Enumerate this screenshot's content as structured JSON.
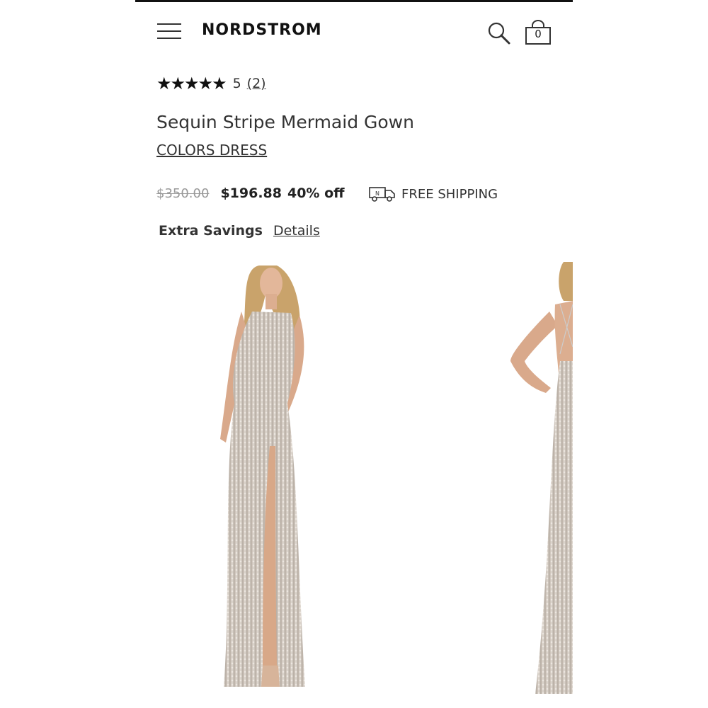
{
  "header": {
    "brand": "NORDSTROM",
    "bag_count": "0",
    "icons": [
      "menu-icon",
      "search-icon",
      "shopping-bag-icon"
    ]
  },
  "rating": {
    "stars": "★★★★★",
    "value": "5",
    "count": "(2)"
  },
  "product": {
    "title": "Sequin Stripe Mermaid Gown",
    "brand": "COLORS DRESS",
    "original_price": "$350.00",
    "sale_price": "$196.88",
    "discount": "40% off",
    "shipping": "FREE SHIPPING",
    "savings_label": "Extra Savings",
    "savings_link": "Details"
  },
  "colors": {
    "text": "#222222",
    "muted": "#999999",
    "gown": "#cfc6bc"
  }
}
